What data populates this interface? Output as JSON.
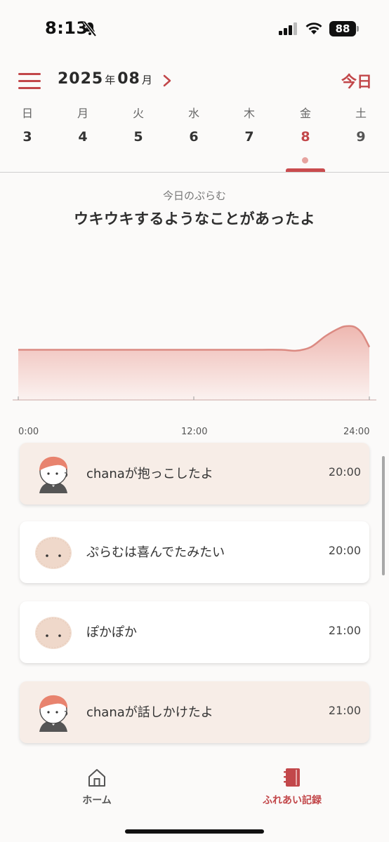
{
  "status": {
    "time": "8:13",
    "battery": "88"
  },
  "header": {
    "year": "2025",
    "year_unit": "年",
    "month": "08",
    "month_unit": "月",
    "today_label": "今日"
  },
  "week": [
    {
      "name": "日",
      "num": "3"
    },
    {
      "name": "月",
      "num": "4"
    },
    {
      "name": "火",
      "num": "5"
    },
    {
      "name": "水",
      "num": "6"
    },
    {
      "name": "木",
      "num": "7"
    },
    {
      "name": "金",
      "num": "8",
      "selected": true
    },
    {
      "name": "土",
      "num": "9"
    }
  ],
  "summary": {
    "subtitle": "今日のぷらむ",
    "title": "ウキウキするようなことがあったよ"
  },
  "chart_data": {
    "type": "area",
    "x_ticks": [
      "0:00",
      "12:00",
      "24:00"
    ],
    "x": [
      0,
      2,
      4,
      6,
      8,
      10,
      12,
      14,
      16,
      18,
      19,
      20,
      21,
      22,
      22.5,
      23,
      23.5,
      24
    ],
    "values": [
      0.55,
      0.55,
      0.55,
      0.55,
      0.55,
      0.55,
      0.55,
      0.55,
      0.55,
      0.55,
      0.54,
      0.58,
      0.7,
      0.79,
      0.81,
      0.8,
      0.73,
      0.58
    ],
    "xlim": [
      0,
      24
    ],
    "ylim": [
      0,
      1
    ],
    "colors": {
      "line": "#db8a82",
      "fill_top": "#eeb7b0",
      "fill_bottom": "#fbf2f0"
    }
  },
  "events": [
    {
      "kind": "person",
      "text": "chanaが抱っこしたよ",
      "time": "20:00"
    },
    {
      "kind": "pet",
      "text": "ぷらむは喜んでたみたい",
      "time": "20:00"
    },
    {
      "kind": "pet",
      "text": "ぽかぽか",
      "time": "21:00"
    },
    {
      "kind": "person",
      "text": "chanaが話しかけたよ",
      "time": "21:00"
    }
  ],
  "nav": {
    "home": "ホーム",
    "log": "ふれあい記録",
    "active": "log"
  },
  "colors": {
    "accent": "#c2474a",
    "card_person": "#f7ede7",
    "card_pet": "#ffffff"
  }
}
